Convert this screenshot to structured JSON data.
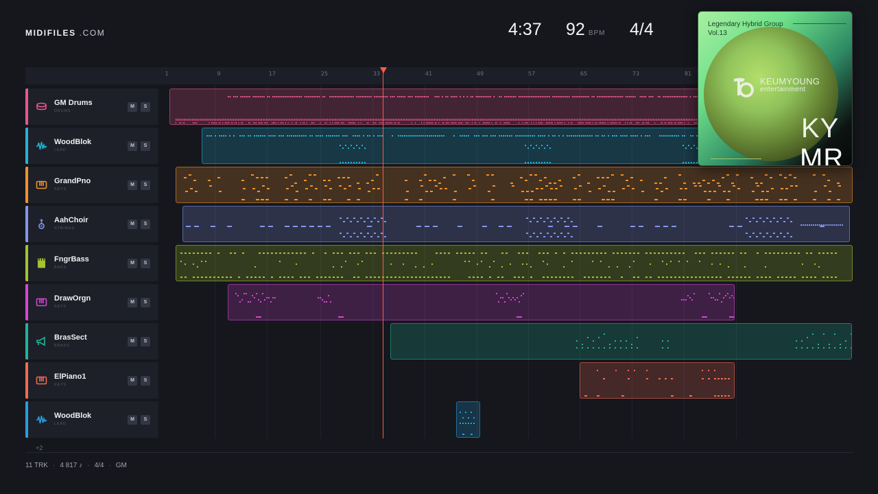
{
  "brand": {
    "name": "MIDIFILES",
    "suffix": ".COM"
  },
  "transport": {
    "time": "4:37",
    "bpm": "92",
    "bpm_unit": "BPM",
    "meter": "4/4"
  },
  "ruler": {
    "ticks": [
      "1",
      "9",
      "17",
      "25",
      "33",
      "41",
      "49",
      "57",
      "65",
      "73",
      "81"
    ]
  },
  "tracks": [
    {
      "name": "GM Drums",
      "type": "DRUMS",
      "color": "#e8588a",
      "icon": "drum-icon",
      "mute": "M",
      "solo": "S"
    },
    {
      "name": "WoodBlok",
      "type": "LEAD",
      "color": "#25b3d4",
      "icon": "waveform-icon",
      "mute": "M",
      "solo": "S"
    },
    {
      "name": "GrandPno",
      "type": "KEYS",
      "color": "#f0922a",
      "icon": "piano-icon",
      "mute": "M",
      "solo": "S"
    },
    {
      "name": "AahChoir",
      "type": "STRINGS",
      "color": "#8496ea",
      "icon": "violin-icon",
      "mute": "M",
      "solo": "S"
    },
    {
      "name": "FngrBass",
      "type": "BASS",
      "color": "#a6c22e",
      "icon": "bass-icon",
      "mute": "M",
      "solo": "S"
    },
    {
      "name": "DrawOrgn",
      "type": "KEYS",
      "color": "#d844d6",
      "icon": "piano-icon",
      "mute": "M",
      "solo": "S"
    },
    {
      "name": "BrasSect",
      "type": "BRASS",
      "color": "#22b49a",
      "icon": "horn-icon",
      "mute": "M",
      "solo": "S"
    },
    {
      "name": "ElPiano1",
      "type": "KEYS",
      "color": "#f06b52",
      "icon": "piano-icon",
      "mute": "M",
      "solo": "S"
    },
    {
      "name": "WoodBlok",
      "type": "LEAD",
      "color": "#25a0e0",
      "icon": "waveform-icon",
      "mute": "M",
      "solo": "S"
    }
  ],
  "more_tracks": "+2",
  "footer": {
    "tracks": "11 TRK",
    "notes": "4 817 ♪",
    "meter": "4/4",
    "standard": "GM"
  },
  "album": {
    "title_line1": "Legendary Hybrid Group",
    "title_line2": "Vol.13",
    "label_name": "KEUMYOUNG",
    "label_sub": "entertainment",
    "mono_top": "KY",
    "mono_bottom": "MR"
  }
}
